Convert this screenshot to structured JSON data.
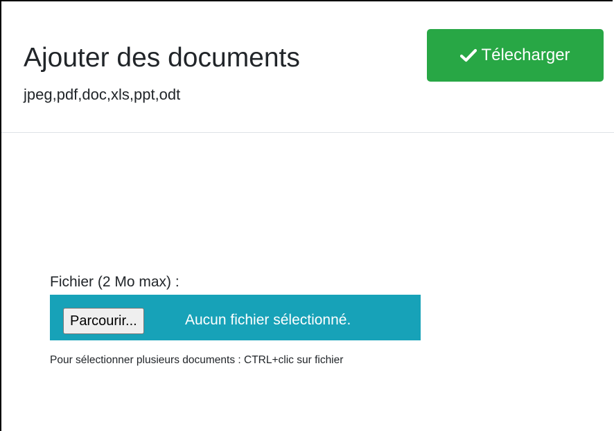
{
  "header": {
    "title": "Ajouter des documents",
    "allowed_types": "jpeg,pdf,doc,xls,ppt,odt",
    "upload_button": {
      "label": "Télecharger",
      "icon": "check-icon",
      "color": "#28a745"
    }
  },
  "form": {
    "file_label": "Fichier (2 Mo max) :",
    "file_input": {
      "browse_label": "Parcourir...",
      "status_text": "Aucun fichier sélectionné.",
      "background_color": "#17a2b8"
    },
    "hint": "Pour sélectionner plusieurs documents : CTRL+clic sur fichier"
  }
}
